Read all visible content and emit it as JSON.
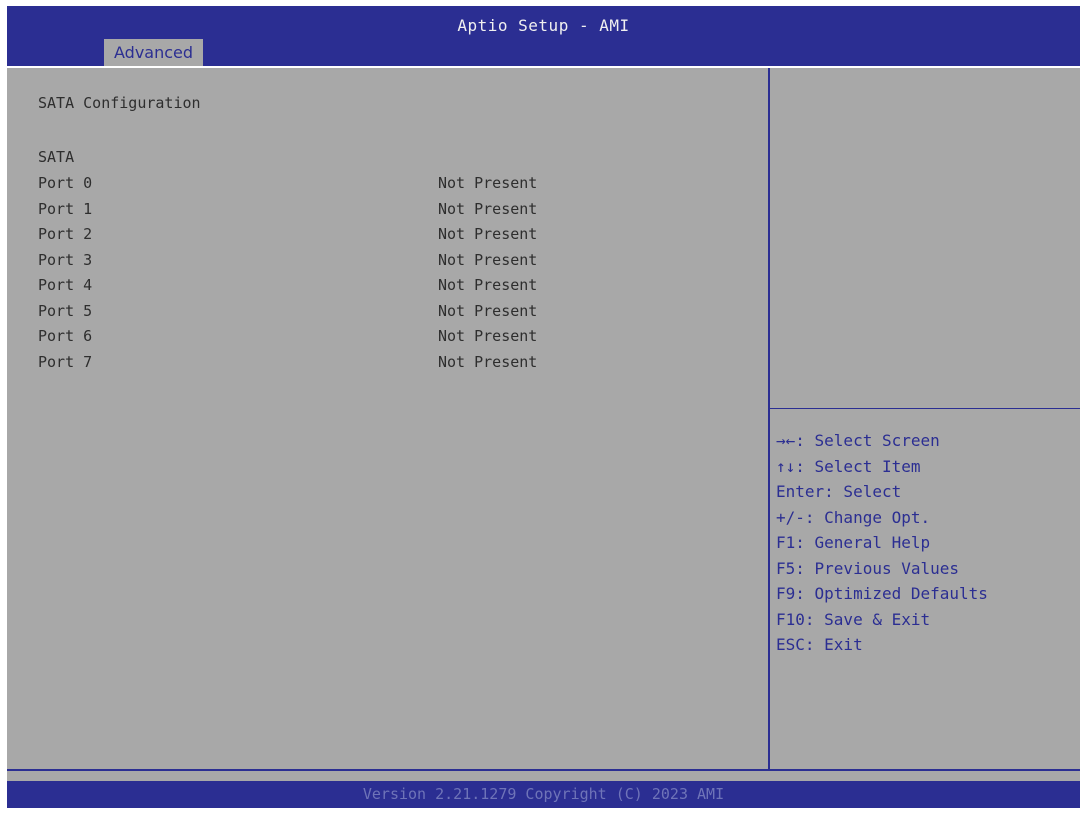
{
  "header": {
    "title": "Aptio Setup - AMI",
    "active_tab": "Advanced"
  },
  "main": {
    "section_title": "SATA Configuration",
    "group_label": "SATA",
    "ports": [
      {
        "label": "Port 0",
        "value": "Not Present"
      },
      {
        "label": "Port 1",
        "value": "Not Present"
      },
      {
        "label": "Port 2",
        "value": "Not Present"
      },
      {
        "label": "Port 3",
        "value": "Not Present"
      },
      {
        "label": "Port 4",
        "value": "Not Present"
      },
      {
        "label": "Port 5",
        "value": "Not Present"
      },
      {
        "label": "Port 6",
        "value": "Not Present"
      },
      {
        "label": "Port 7",
        "value": "Not Present"
      }
    ]
  },
  "help": {
    "keys": [
      "→←: Select Screen",
      "↑↓: Select Item",
      "Enter: Select",
      "+/-: Change Opt.",
      "F1: General Help",
      "F5: Previous Values",
      "F9: Optimized Defaults",
      "F10: Save & Exit",
      "ESC: Exit"
    ]
  },
  "footer": {
    "version_text": "Version 2.21.1279 Copyright (C) 2023 AMI"
  },
  "colors": {
    "header_blue": "#2b2e92",
    "panel_gray": "#a8a8a8",
    "text_dark": "#2e2e2e",
    "help_text": "#2b2e92",
    "footer_text": "#6f74b8"
  }
}
